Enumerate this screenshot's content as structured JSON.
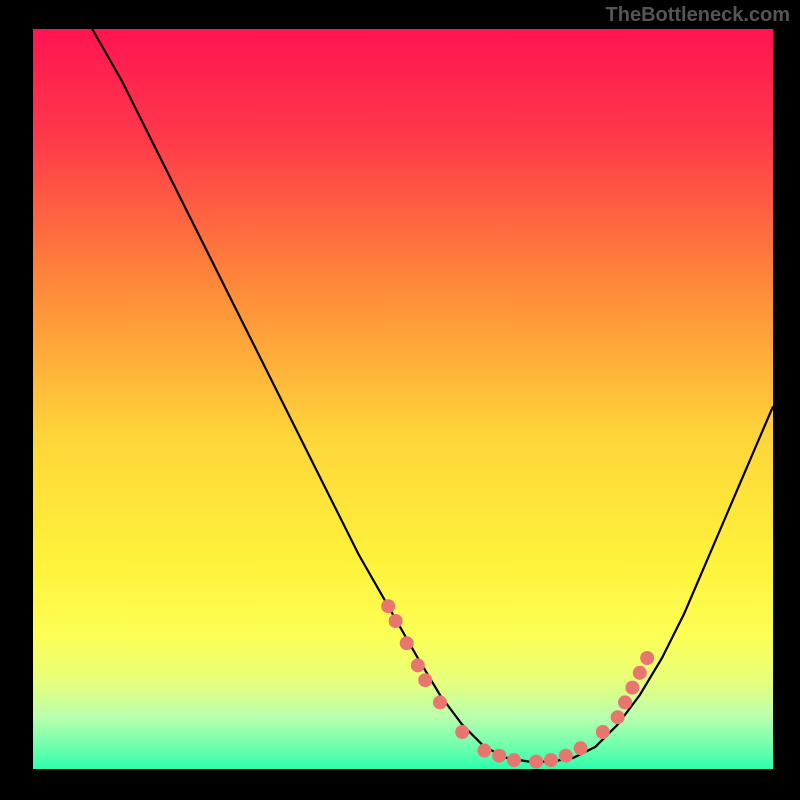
{
  "watermark": "TheBottleneck.com",
  "chart_data": {
    "type": "line",
    "title": "",
    "xlabel": "",
    "ylabel": "",
    "xlim": [
      0,
      100
    ],
    "ylim": [
      0,
      100
    ],
    "curve": {
      "name": "bottleneck-curve",
      "x": [
        8,
        12,
        16,
        20,
        24,
        28,
        32,
        36,
        40,
        44,
        48,
        52,
        55,
        58,
        61,
        64,
        67,
        70,
        73,
        76,
        79,
        82,
        85,
        88,
        91,
        94,
        97,
        100
      ],
      "y": [
        100,
        93,
        85,
        77,
        69,
        61,
        53,
        45,
        37,
        29,
        22,
        15,
        10,
        6,
        3,
        1.5,
        1,
        1,
        1.5,
        3,
        6,
        10,
        15,
        21,
        28,
        35,
        42,
        49
      ]
    },
    "markers": {
      "name": "optimal-range-markers",
      "color": "#e8766f",
      "points": [
        {
          "x": 48,
          "y": 22
        },
        {
          "x": 49,
          "y": 20
        },
        {
          "x": 50.5,
          "y": 17
        },
        {
          "x": 52,
          "y": 14
        },
        {
          "x": 53,
          "y": 12
        },
        {
          "x": 55,
          "y": 9
        },
        {
          "x": 58,
          "y": 5
        },
        {
          "x": 61,
          "y": 2.5
        },
        {
          "x": 63,
          "y": 1.8
        },
        {
          "x": 65,
          "y": 1.2
        },
        {
          "x": 68,
          "y": 1
        },
        {
          "x": 70,
          "y": 1.2
        },
        {
          "x": 72,
          "y": 1.8
        },
        {
          "x": 74,
          "y": 2.8
        },
        {
          "x": 77,
          "y": 5
        },
        {
          "x": 79,
          "y": 7
        },
        {
          "x": 80,
          "y": 9
        },
        {
          "x": 81,
          "y": 11
        },
        {
          "x": 82,
          "y": 13
        },
        {
          "x": 83,
          "y": 15
        }
      ]
    },
    "gradient_stops": [
      {
        "offset": 0,
        "color": "#ff1452"
      },
      {
        "offset": 0.15,
        "color": "#ff3a4a"
      },
      {
        "offset": 0.35,
        "color": "#ff8a3a"
      },
      {
        "offset": 0.55,
        "color": "#ffd53a"
      },
      {
        "offset": 0.72,
        "color": "#fff23a"
      },
      {
        "offset": 0.82,
        "color": "#fcff55"
      },
      {
        "offset": 0.88,
        "color": "#e8ff7a"
      },
      {
        "offset": 0.93,
        "color": "#b8ffad"
      },
      {
        "offset": 0.97,
        "color": "#6effac"
      },
      {
        "offset": 1.0,
        "color": "#2dffae"
      }
    ]
  }
}
